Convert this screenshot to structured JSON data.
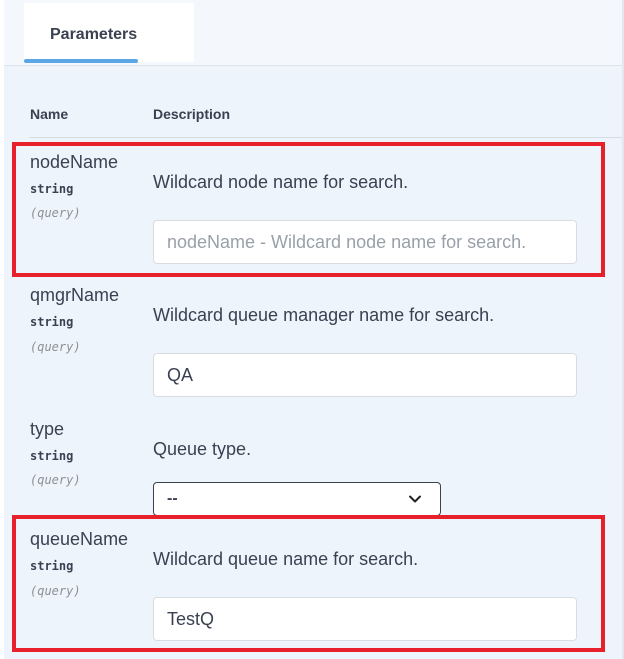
{
  "tab": {
    "label": "Parameters"
  },
  "columns": {
    "name": "Name",
    "description": "Description"
  },
  "params": [
    {
      "name": "nodeName",
      "type": "string",
      "in": "(query)",
      "description": "Wildcard node name for search.",
      "value": "",
      "placeholder": "nodeName - Wildcard node name for search."
    },
    {
      "name": "qmgrName",
      "type": "string",
      "in": "(query)",
      "description": "Wildcard queue manager name for search.",
      "value": "QA",
      "placeholder": ""
    },
    {
      "name": "type",
      "type": "string",
      "in": "(query)",
      "description": "Queue type.",
      "selected": "--"
    },
    {
      "name": "queueName",
      "type": "string",
      "in": "(query)",
      "description": "Wildcard queue name for search.",
      "value": "TestQ",
      "placeholder": ""
    }
  ],
  "colors": {
    "accent": "#5ba7e6",
    "highlight": "#e8202c",
    "background": "#eef4fb"
  },
  "icons": {
    "select_arrow": "chevron-down-icon"
  }
}
